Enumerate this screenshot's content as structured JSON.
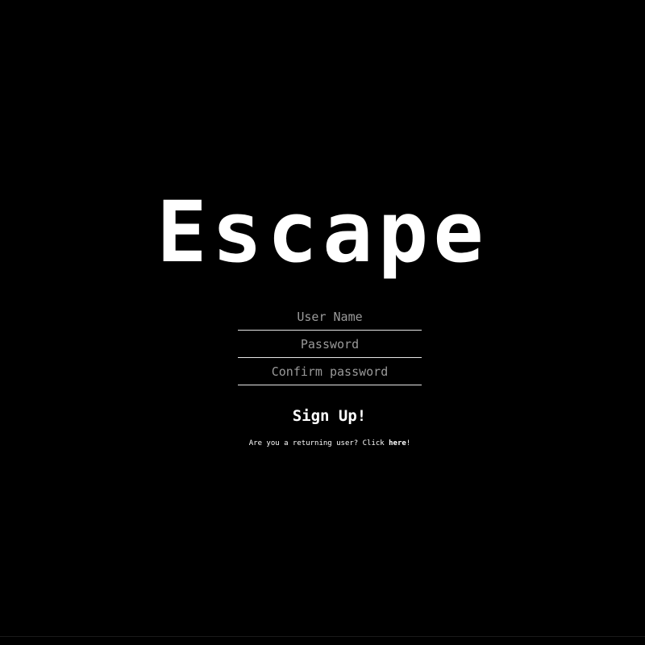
{
  "app": {
    "title": "Escape"
  },
  "form": {
    "username_placeholder": "User Name",
    "password_placeholder": "Password",
    "confirm_placeholder": "Confirm password",
    "submit_label": "Sign Up!"
  },
  "returning": {
    "text_before": "Are you a returning user? Click ",
    "link_label": "here",
    "text_after": "!"
  },
  "colors": {
    "background": "#000000",
    "text": "#ffffff",
    "placeholder": "#9a9a9a",
    "underline": "#e6e6e6"
  }
}
